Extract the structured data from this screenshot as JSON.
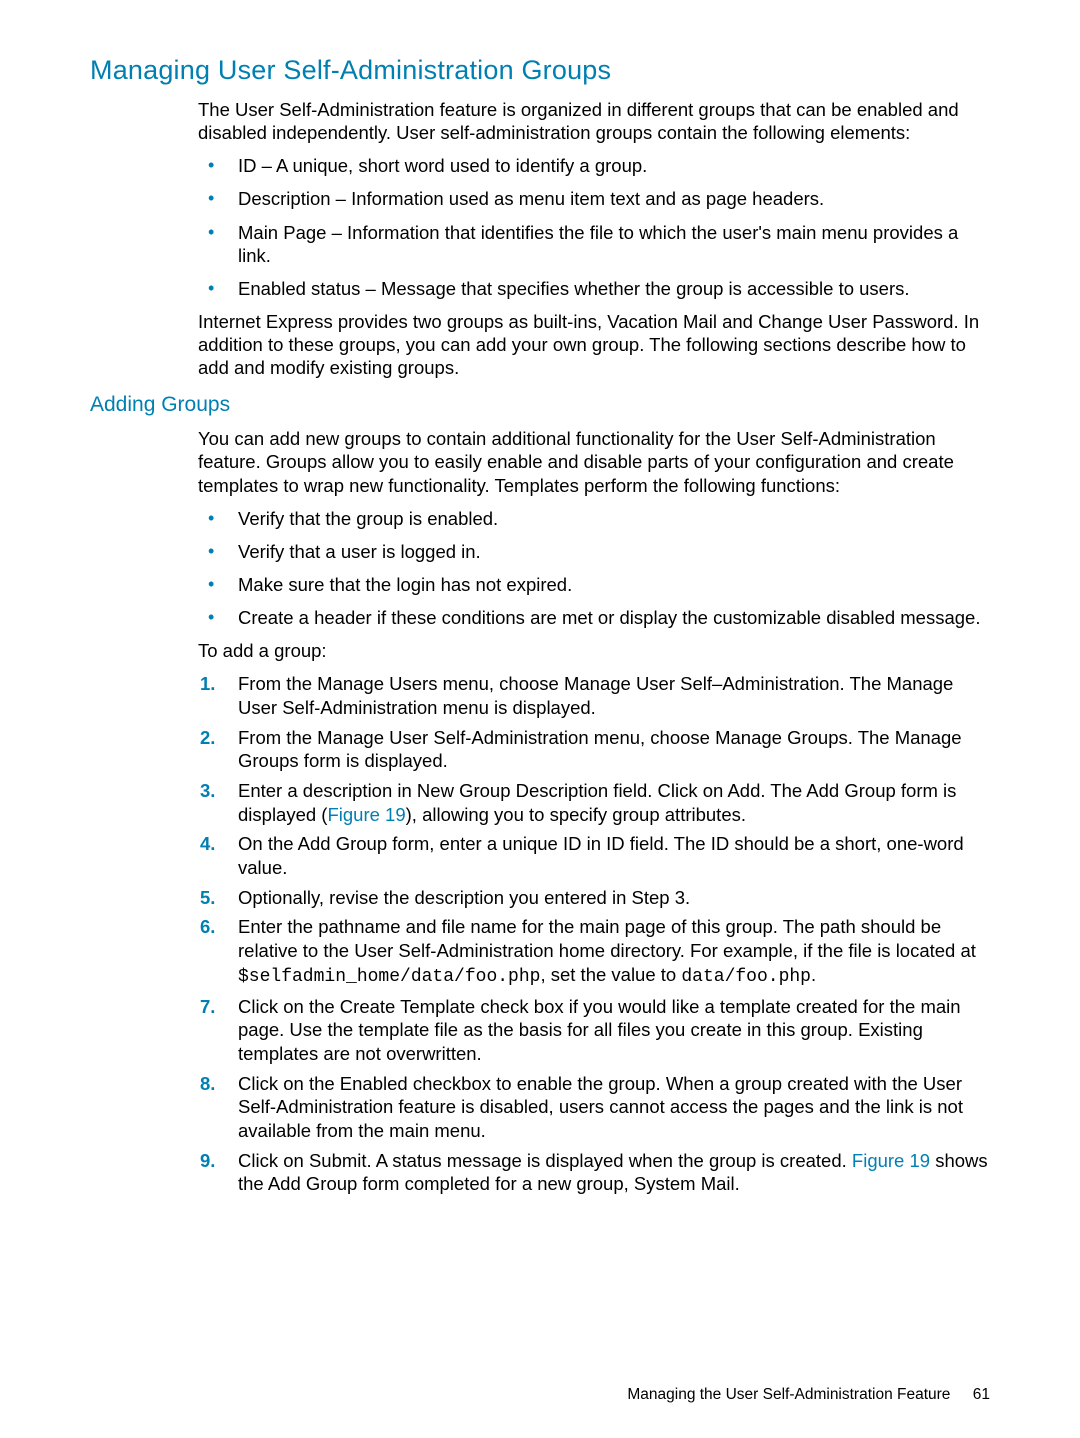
{
  "section_title": "Managing User Self-Administration Groups",
  "intro_para": "The User Self-Administration feature is organized in different groups that can be enabled and disabled independently. User self-administration groups contain the following elements:",
  "intro_bullets": [
    "ID – A unique, short word used to identify a group.",
    "Description – Information used as menu item text and as page headers.",
    "Main Page – Information that identifies the file to which the user's main menu provides a link.",
    "Enabled status – Message that specifies whether the group is accessible to users."
  ],
  "intro_after": "Internet Express provides two groups as built-ins, Vacation Mail and Change User Password. In addition to these groups, you can add your own group. The following sections describe how to add and modify existing groups.",
  "subsection_title": "Adding Groups",
  "sub_intro": "You can add new groups to contain additional functionality for the User Self-Administration feature. Groups allow you to easily enable and disable parts of your configuration and create templates to wrap new functionality. Templates perform the following functions:",
  "sub_bullets": [
    "Verify that the group is enabled.",
    "Verify that a user is logged in.",
    "Make sure that the login has not expired.",
    "Create a header if these conditions are met or display the customizable disabled message."
  ],
  "to_add": "To add a group:",
  "steps": {
    "s1": "From the Manage Users menu, choose Manage User Self–Administration. The Manage User Self-Administration menu is displayed.",
    "s2": "From the Manage User Self-Administration menu, choose Manage Groups. The Manage Groups form is displayed.",
    "s3_a": "Enter a description in New Group Description field. Click on Add. The Add Group form is displayed (",
    "s3_link": "Figure 19",
    "s3_b": "), allowing you to specify group attributes.",
    "s4": "On the Add Group form, enter a unique ID in ID field. The ID should be a short, one-word value.",
    "s5": "Optionally, revise the description you entered in Step 3.",
    "s6_a": "Enter the pathname and file name for the main page of this group. The path should be relative to the User Self-Administration home directory. For example, if the file is located at ",
    "s6_code1": "$selfadmin_home/data/foo.php",
    "s6_b": ", set the value to ",
    "s6_code2": "data/foo.php",
    "s6_c": ".",
    "s7": "Click on the Create Template check box if you would like a template created for the main page. Use the template file as the basis for all files you create in this group. Existing templates are not overwritten.",
    "s8": "Click on the Enabled checkbox to enable the group. When a group created with the User Self-Administration feature is disabled, users cannot access the pages and the link is not available from the main menu.",
    "s9_a": "Click on Submit. A status message is displayed when the group is created. ",
    "s9_link": "Figure 19",
    "s9_b": " shows the Add Group form completed for a new group, System Mail."
  },
  "footer_text": "Managing the User Self-Administration Feature",
  "page_number": "61"
}
